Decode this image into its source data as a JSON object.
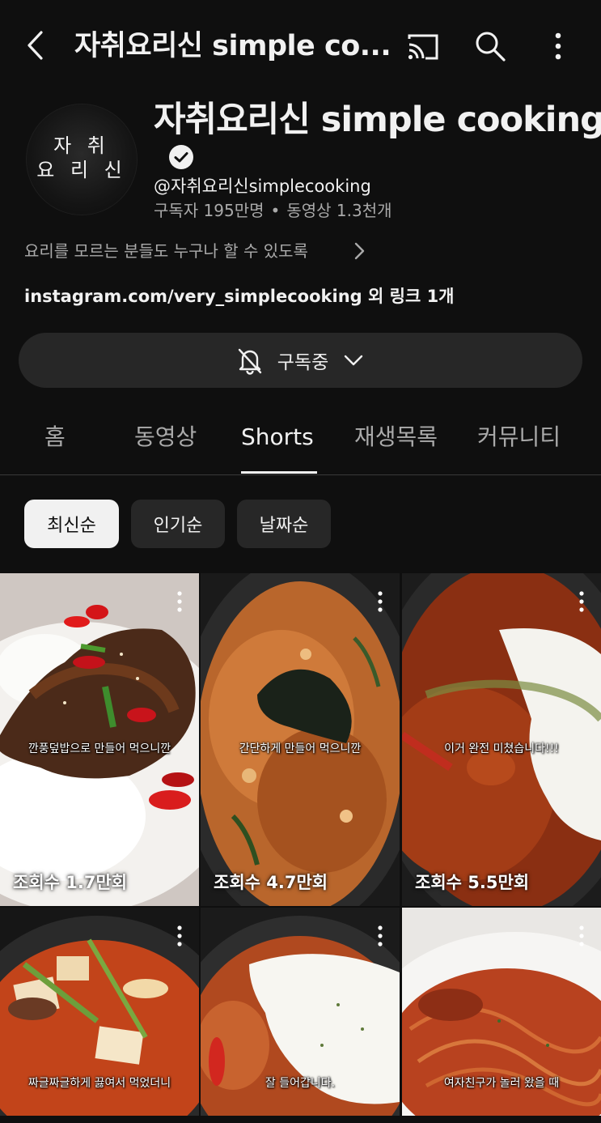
{
  "header": {
    "title": "자취요리신 simple co...",
    "back_icon": "arrow-back-icon",
    "cast_icon": "cast-icon",
    "search_icon": "search-icon",
    "more_icon": "more-vert-icon"
  },
  "channel": {
    "avatar_text_line1": "자  취",
    "avatar_text_line2": "요 리 신",
    "name": "자취요리신 simple cooking",
    "handle": "@자취요리신simplecooking",
    "subscribers": "구독자 195만명",
    "separator": "•",
    "videos": "동영상 1.3천개",
    "description": "요리를 모르는 분들도 누구나 할 수 있도록",
    "links": "instagram.com/very_simplecooking 외 링크 1개"
  },
  "subscribe": {
    "label": "구독중",
    "bell_icon": "bell-off-icon",
    "chevron_icon": "chevron-down-icon"
  },
  "tabs": [
    {
      "label": "홈",
      "active": false
    },
    {
      "label": "동영상",
      "active": false
    },
    {
      "label": "Shorts",
      "active": true
    },
    {
      "label": "재생목록",
      "active": false
    },
    {
      "label": "커뮤니티",
      "active": false
    }
  ],
  "chips": [
    {
      "label": "최신순",
      "selected": true
    },
    {
      "label": "인기순",
      "selected": false
    },
    {
      "label": "날짜순",
      "selected": false
    }
  ],
  "shorts": [
    {
      "caption": "깐풍덮밥으로 만들어 먹으니깐",
      "views": "조회수 1.7만회"
    },
    {
      "caption": "간단하게 만들어 먹으니깐",
      "views": "조회수 4.7만회"
    },
    {
      "caption": "이거 완전 미쳤습니다!!!",
      "views": "조회수 5.5만회"
    },
    {
      "caption": "짜글짜글하게 끓여서 먹었더니",
      "views": ""
    },
    {
      "caption": "잘 들어갑니다.",
      "views": ""
    },
    {
      "caption": "여자친구가 놀러 왔을 때",
      "views": ""
    }
  ],
  "colors": {
    "background": "#0f0f0f",
    "surface": "#272727",
    "text_primary": "#f1f1f1",
    "text_secondary": "#aaaaaa"
  }
}
